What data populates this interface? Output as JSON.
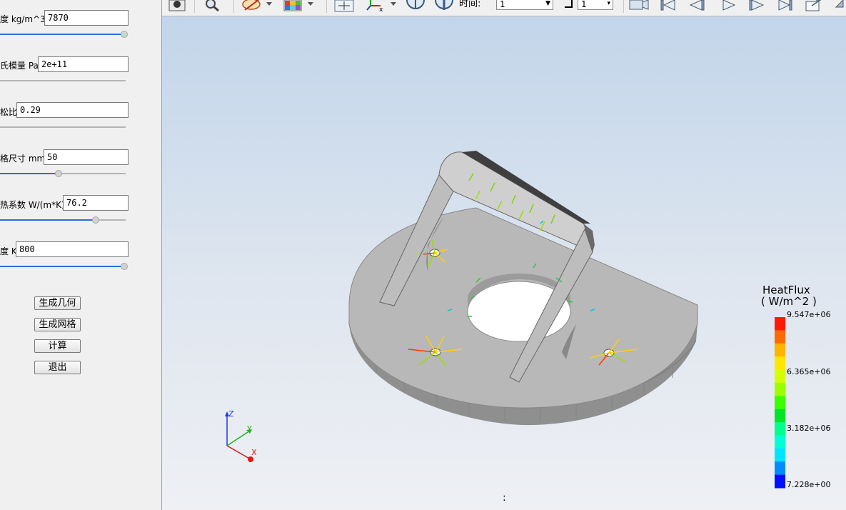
{
  "params": [
    {
      "label": "度 kg/m^3",
      "value": "7870",
      "slider": 1.0
    },
    {
      "label": "氏模量 Pa",
      "value": "2e+11",
      "slider": null
    },
    {
      "label": "松比",
      "value": "0.29",
      "slider": null
    },
    {
      "label": "格尺寸 mm",
      "value": "50",
      "slider": 0.47
    },
    {
      "label": "热系数 W/(m*K)",
      "value": "76.2",
      "slider": 0.76
    },
    {
      "label": "度 K",
      "value": "800",
      "slider": 1.0
    }
  ],
  "buttons": {
    "geometry": "生成几何",
    "mesh": "生成网格",
    "compute": "计算",
    "exit": "退出"
  },
  "toolbar": {
    "time_label": "时间:",
    "time_value": "1",
    "step_value": "1"
  },
  "legend": {
    "title": "HeatFlux",
    "unit": "( W/m^2 )",
    "ticks": [
      "9.547e+06",
      "6.365e+06",
      "3.182e+06",
      "7.228e+00"
    ],
    "colors": [
      "#ff1a00",
      "#ff6a00",
      "#ffb400",
      "#ffe600",
      "#d4ff00",
      "#9cff00",
      "#3cff00",
      "#00e42a",
      "#00ff8c",
      "#00ffd4",
      "#00e4ff",
      "#008cff",
      "#0010ff"
    ]
  },
  "axes": {
    "x": "X",
    "y": "Y",
    "z": "Z"
  },
  "status": ":"
}
